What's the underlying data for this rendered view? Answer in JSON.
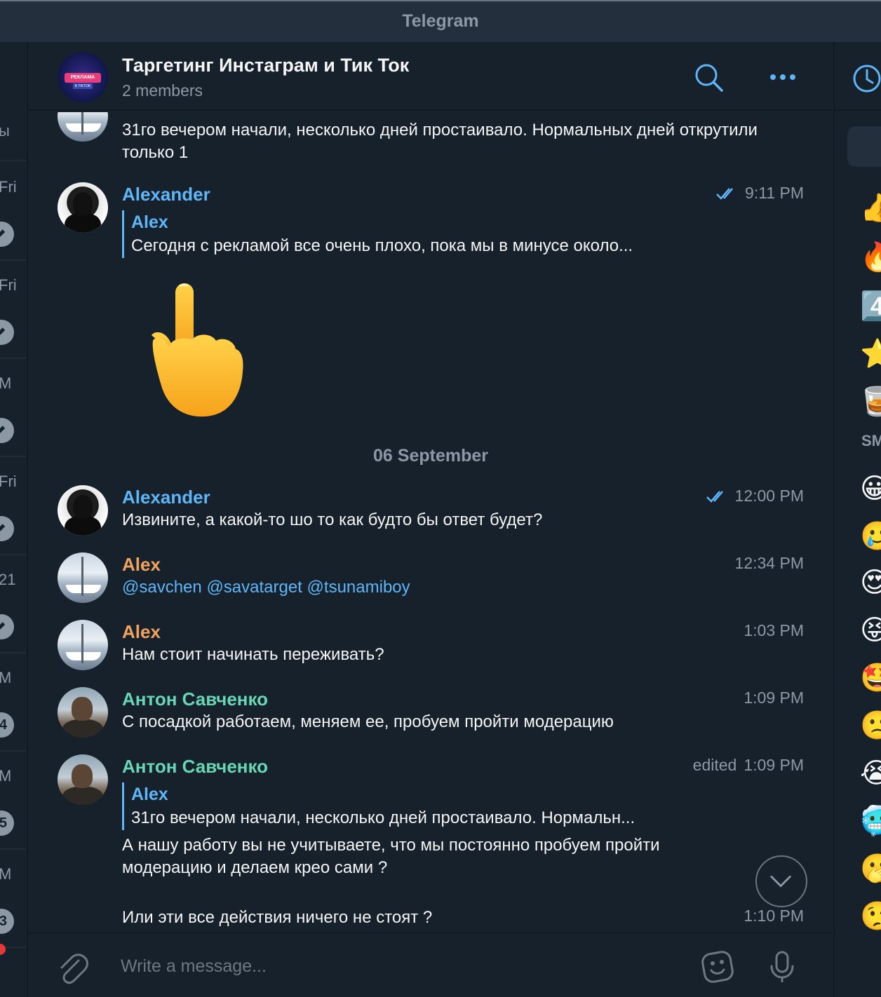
{
  "app": {
    "window_title": "Telegram"
  },
  "left_sidebar": {
    "slots": [
      {
        "text": "ы",
        "pinned": false,
        "badge": ""
      },
      {
        "text": "Fri",
        "pinned": true,
        "badge": ""
      },
      {
        "text": "Fri",
        "pinned": true,
        "badge": ""
      },
      {
        "text": "M",
        "pinned": true,
        "badge": ""
      },
      {
        "text": "Fri",
        "pinned": true,
        "badge": ""
      },
      {
        "text": "21",
        "pinned": true,
        "badge": ""
      },
      {
        "text": "M",
        "pinned": false,
        "badge": "4"
      },
      {
        "text": "M",
        "pinned": false,
        "badge": "5"
      },
      {
        "text": "M",
        "pinned": false,
        "badge": "3"
      }
    ]
  },
  "chat": {
    "title": "Таргетинг Инстаграм и Тик Ток",
    "members": "2 members",
    "avatar_text": "РЕКЛАМА",
    "avatar_subtext": "В TIKTOK",
    "messages": [
      {
        "id": "m0",
        "sender": "",
        "text": "31го вечером начали, несколько дней простаивало. Нормальных дней открутили только 1"
      },
      {
        "id": "m1",
        "sender": "Alexander",
        "time": "9:11 PM",
        "read": true,
        "reply": {
          "name": "Alex",
          "text": "Сегодня с рекламой все очень плохо, пока мы в минусе около..."
        }
      },
      {
        "id": "m2",
        "sender": "Alexander",
        "time": "12:00 PM",
        "read": true,
        "text": "Извините, а какой-то шо то как будто бы ответ будет?"
      },
      {
        "id": "m3",
        "sender": "Alex",
        "time": "12:34 PM",
        "mentions": [
          "@savchen",
          "@savatarget",
          "@tsunamiboy"
        ]
      },
      {
        "id": "m4",
        "sender": "Alex",
        "time": "1:03 PM",
        "text": "Нам стоит начинать переживать?"
      },
      {
        "id": "m5",
        "sender": "Антон Савченко",
        "time": "1:09 PM",
        "text": "С посадкой работаем, меняем ее, пробуем пройти модерацию"
      },
      {
        "id": "m6",
        "sender": "Антон Савченко",
        "edited": "edited",
        "time": "1:09 PM",
        "reply": {
          "name": "Alex",
          "text": "31го вечером начали, несколько дней простаивало. Нормальн..."
        },
        "text1": "А нашу работу вы не учитываете, что мы постоянно пробуем пройти модерацию и делаем крео сами ?",
        "text2": "Или эти все действия ничего не стоят ?",
        "time2": "1:10 PM"
      }
    ],
    "date_separator": "06 September"
  },
  "composer": {
    "placeholder": "Write a message..."
  },
  "emoji_panel": {
    "section_label": "SM",
    "recent": [
      "👍",
      "🔥",
      "4️⃣",
      "⭐",
      "🥃"
    ],
    "smileys": [
      "😀",
      "🥲",
      "😍",
      "😝",
      "🤩",
      "🙁",
      "😭",
      "🥶",
      "🫢",
      "🤥"
    ]
  },
  "colors": {
    "background": "#17212b",
    "header": "#242f3d",
    "accent": "#5eb5f7",
    "sender_orange": "#f0a35e",
    "sender_green": "#67d6b5",
    "muted": "#8d98a5"
  },
  "icons": {
    "search": "search-icon",
    "more": "more-icon",
    "history": "clock-icon",
    "attach": "paperclip-icon",
    "sticker": "sticker-icon",
    "mic": "microphone-icon",
    "scroll": "chevron-down-icon"
  }
}
